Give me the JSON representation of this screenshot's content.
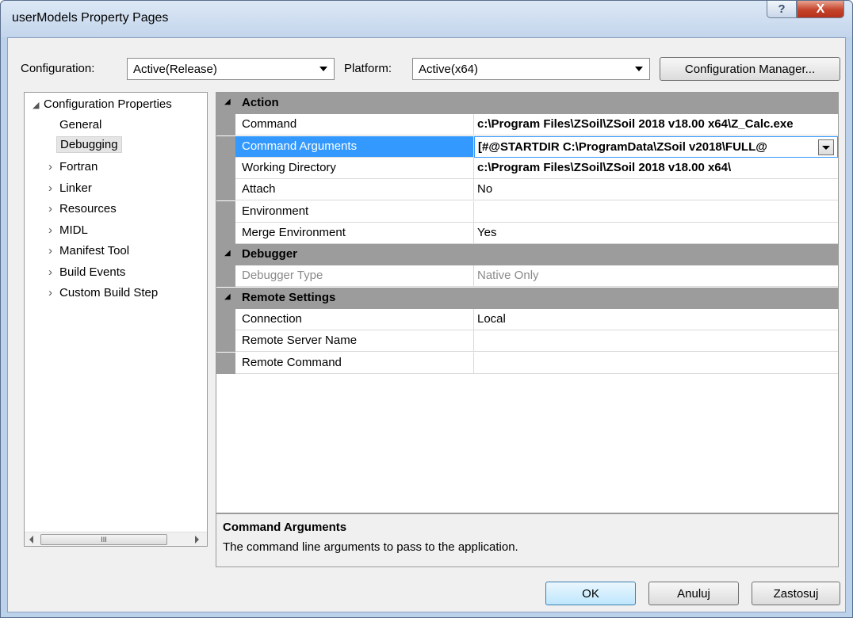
{
  "window": {
    "title": "userModels Property Pages",
    "help_icon": "help-icon",
    "close_icon": "close-icon",
    "help_glyph": "?",
    "close_glyph": "X"
  },
  "toolbar": {
    "configuration_label": "Configuration:",
    "configuration_value": "Active(Release)",
    "platform_label": "Platform:",
    "platform_value": "Active(x64)",
    "config_manager_label": "Configuration Manager..."
  },
  "tree": {
    "root": "Configuration Properties",
    "items": [
      {
        "label": "General",
        "expandable": false
      },
      {
        "label": "Debugging",
        "expandable": false,
        "selected": true
      },
      {
        "label": "Fortran",
        "expandable": true
      },
      {
        "label": "Linker",
        "expandable": true
      },
      {
        "label": "Resources",
        "expandable": true
      },
      {
        "label": "MIDL",
        "expandable": true
      },
      {
        "label": "Manifest Tool",
        "expandable": true
      },
      {
        "label": "Build Events",
        "expandable": true
      },
      {
        "label": "Custom Build Step",
        "expandable": true
      }
    ],
    "scroll_thumb_glyph": "III"
  },
  "grid": {
    "categories": [
      {
        "name": "Action",
        "rows": [
          {
            "name": "Command",
            "value": "c:\\Program Files\\ZSoil\\ZSoil 2018 v18.00 x64\\Z_Calc.exe",
            "bold": true
          },
          {
            "name": "Command Arguments",
            "value": "[#@STARTDIR C:\\ProgramData\\ZSoil v2018\\FULL@",
            "bold": true,
            "selected": true
          },
          {
            "name": "Working Directory",
            "value": "c:\\Program Files\\ZSoil\\ZSoil 2018 v18.00 x64\\",
            "bold": true
          },
          {
            "name": "Attach",
            "value": "No"
          },
          {
            "name": "Environment",
            "value": ""
          },
          {
            "name": "Merge Environment",
            "value": "Yes"
          }
        ]
      },
      {
        "name": "Debugger",
        "rows": [
          {
            "name": "Debugger Type",
            "value": "Native Only",
            "disabled": true
          }
        ]
      },
      {
        "name": "Remote Settings",
        "rows": [
          {
            "name": "Connection",
            "value": "Local"
          },
          {
            "name": "Remote Server Name",
            "value": ""
          },
          {
            "name": "Remote Command",
            "value": ""
          }
        ]
      }
    ]
  },
  "description": {
    "title": "Command Arguments",
    "text": "The command line arguments to pass to the application."
  },
  "buttons": {
    "ok": "OK",
    "cancel": "Anuluj",
    "apply": "Zastosuj"
  },
  "colors": {
    "selection": "#3399ff",
    "category_band": "#9c9c9c"
  }
}
